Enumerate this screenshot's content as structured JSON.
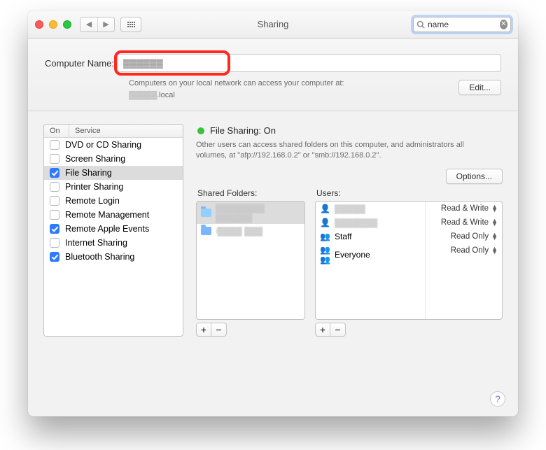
{
  "window": {
    "title": "Sharing"
  },
  "search": {
    "value": "name"
  },
  "header": {
    "label": "Computer Name:",
    "value": "▓▓▓▓▓▓",
    "sub1": "Computers on your local network can access your computer at:",
    "sub2_blur": "▓▓▓▓▓",
    "sub2_suffix": ".local",
    "edit": "Edit..."
  },
  "services": {
    "col_on": "On",
    "col_service": "Service",
    "items": [
      {
        "label": "DVD or CD Sharing",
        "on": false,
        "selected": false
      },
      {
        "label": "Screen Sharing",
        "on": false,
        "selected": false
      },
      {
        "label": "File Sharing",
        "on": true,
        "selected": true
      },
      {
        "label": "Printer Sharing",
        "on": false,
        "selected": false
      },
      {
        "label": "Remote Login",
        "on": false,
        "selected": false
      },
      {
        "label": "Remote Management",
        "on": false,
        "selected": false
      },
      {
        "label": "Remote Apple Events",
        "on": true,
        "selected": false
      },
      {
        "label": "Internet Sharing",
        "on": false,
        "selected": false
      },
      {
        "label": "Bluetooth Sharing",
        "on": true,
        "selected": false
      }
    ]
  },
  "detail": {
    "status_label": "File Sharing: On",
    "desc": "Other users can access shared folders on this computer, and administrators all volumes, at \"afp://192.168.0.2\" or \"smb://192.168.0.2\".",
    "options": "Options...",
    "folders_label": "Shared Folders:",
    "users_label": "Users:",
    "folders": [
      {
        "label": "▓▓▓▓▓▓▓▓ ▓▓▓▓▓▓",
        "selected": true,
        "kind": "pub"
      },
      {
        "label": "i▓▓▓▓ ▓▓▓",
        "selected": false,
        "kind": ""
      }
    ],
    "users": [
      {
        "name": "▓▓▓▓▓",
        "icon": "person",
        "perm": "Read & Write"
      },
      {
        "name": "▓▓▓▓▓▓▓",
        "icon": "person",
        "perm": "Read & Write"
      },
      {
        "name": "Staff",
        "icon": "pair",
        "perm": "Read Only"
      },
      {
        "name": "Everyone",
        "icon": "group",
        "perm": "Read Only"
      }
    ]
  }
}
